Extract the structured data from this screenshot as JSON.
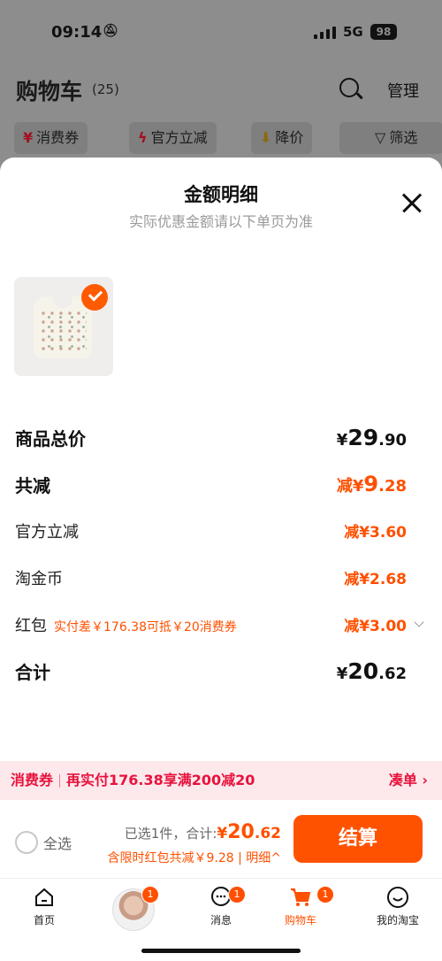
{
  "status": {
    "time": "09:14",
    "network": "5G",
    "battery": "98"
  },
  "header": {
    "title": "购物车",
    "count": "(25)",
    "manage": "管理"
  },
  "filters": [
    {
      "icon": "¥",
      "label": "消费券"
    },
    {
      "icon": "ϟ",
      "label": "官方立减"
    },
    {
      "icon": "⬇",
      "label": "降价"
    },
    {
      "icon": "▽",
      "label": "筛选"
    }
  ],
  "sheet": {
    "title": "金额明细",
    "subtitle": "实际优惠金额请以下单页为准",
    "rows": {
      "total": {
        "label": "商品总价",
        "sym": "¥",
        "int": "29",
        "dec": ".90"
      },
      "reduce": {
        "label": "共减",
        "pre": "减¥",
        "int": "9",
        "dec": ".28"
      },
      "official": {
        "label": "官方立减",
        "value": "减¥3.60"
      },
      "coins": {
        "label": "淘金币",
        "value": "减¥2.68"
      },
      "redpacket": {
        "label": "红包",
        "note": "实付差￥176.38可抵￥20消费券",
        "value": "减¥3.00"
      },
      "sum": {
        "label": "合计",
        "sym": "¥",
        "int": "20",
        "dec": ".62"
      }
    }
  },
  "coupon_bar": {
    "tag": "消费券",
    "text": "再实付176.38享满200减20",
    "action": "凑单 ›"
  },
  "checkout": {
    "select_all": "全选",
    "selected": "已选1件，合计:",
    "amount_sym": "¥",
    "amount_int": "20",
    "amount_dec": ".62",
    "promo": "含限时红包共减￥9.28 | 明细^",
    "pay": "结算"
  },
  "tabs": [
    {
      "label": "首页",
      "badge": ""
    },
    {
      "label": "",
      "badge": "1"
    },
    {
      "label": "消息",
      "badge": "1"
    },
    {
      "label": "购物车",
      "badge": "1"
    },
    {
      "label": "我的淘宝",
      "badge": ""
    }
  ],
  "colors": {
    "accent": "#ff5000",
    "coupon": "#e8123c"
  }
}
